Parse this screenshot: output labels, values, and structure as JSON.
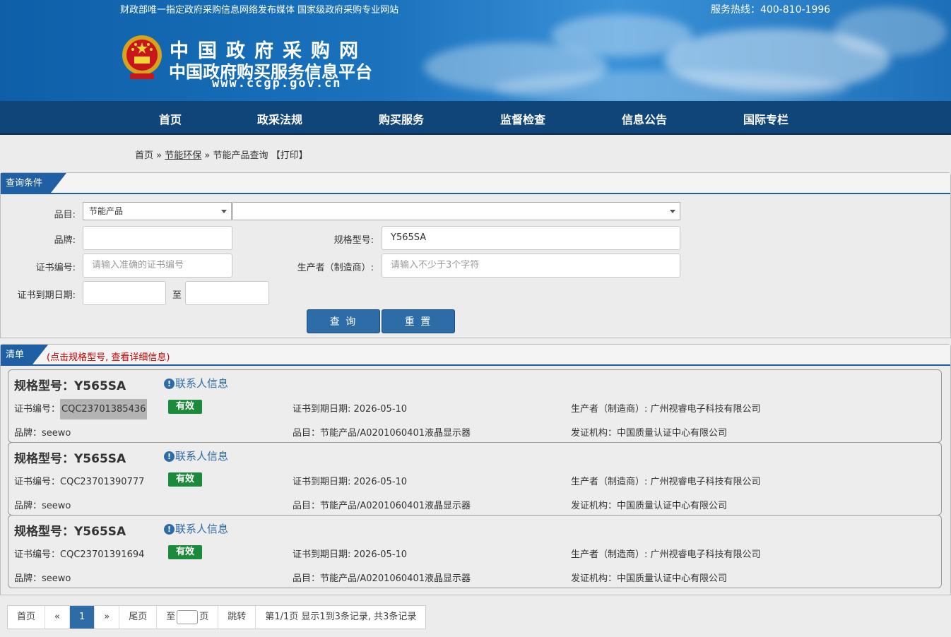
{
  "header": {
    "slogan": "财政部唯一指定政府采购信息网络发布媒体 国家级政府采购专业网站",
    "hotline": "服务热线：400-810-1996",
    "site_name": "中国政府采购网",
    "site_subname": "中国政府购买服务信息平台",
    "site_url": "www.ccgp.gov.cn",
    "brand_color": "#1a72bd"
  },
  "nav": {
    "items": [
      "首页",
      "政采法规",
      "购买服务",
      "监督检查",
      "信息公告",
      "国际专栏"
    ]
  },
  "breadcrumb": {
    "home": "首页",
    "sep1": "»",
    "section": "节能环保",
    "sep2": "»",
    "current": "节能产品查询",
    "print": "【打印】"
  },
  "query": {
    "tab": "查询条件",
    "category_label": "品目:",
    "category_value": "节能产品",
    "subcategory_value": "",
    "brand_label": "品牌:",
    "brand_value": "",
    "model_label": "规格型号:",
    "model_value": "Y565SA",
    "cert_label": "证书编号:",
    "cert_placeholder": "请输入准确的证书编号",
    "maker_label": "生产者（制造商）:",
    "maker_placeholder": "请输入不少于3个字符",
    "expire_label": "证书到期日期:",
    "to_label": "至",
    "search_btn": "查 询",
    "reset_btn": "重 置"
  },
  "list": {
    "tab": "清单",
    "hint": "(点击规格型号, 查看详细信息)",
    "contact_label": "联系人信息",
    "status_color": "#1b8a3b",
    "items": [
      {
        "title": "规格型号：Y565SA",
        "cert": "CQC23701385436",
        "cert_prefix": "证书编号：",
        "status": "有效",
        "expire": "证书到期日期: 2026-05-10",
        "maker": "生产者（制造商）: 广州视睿电子科技有限公司",
        "brand": "品牌：seewo",
        "category": "品目：节能产品/A0201060401液晶显示器",
        "issuer": "发证机构：中国质量认证中心有限公司"
      },
      {
        "title": "规格型号：Y565SA",
        "cert": "CQC23701390777",
        "cert_prefix": "证书编号：",
        "status": "有效",
        "expire": "证书到期日期: 2026-05-10",
        "maker": "生产者（制造商）: 广州视睿电子科技有限公司",
        "brand": "品牌：seewo",
        "category": "品目：节能产品/A0201060401液晶显示器",
        "issuer": "发证机构：中国质量认证中心有限公司"
      },
      {
        "title": "规格型号：Y565SA",
        "cert": "CQC23701391694",
        "cert_prefix": "证书编号：",
        "status": "有效",
        "expire": "证书到期日期: 2026-05-10",
        "maker": "生产者（制造商）: 广州视睿电子科技有限公司",
        "brand": "品牌：seewo",
        "category": "品目：节能产品/A0201060401液晶显示器",
        "issuer": "发证机构：中国质量认证中心有限公司"
      }
    ]
  },
  "pager": {
    "first": "首页",
    "prev": "«",
    "current": "1",
    "next": "»",
    "last": "尾页",
    "goto_prefix": "至",
    "goto_suffix": "页",
    "jump": "跳转",
    "summary": "第1/1页  显示1到3条记录, 共3条记录"
  }
}
